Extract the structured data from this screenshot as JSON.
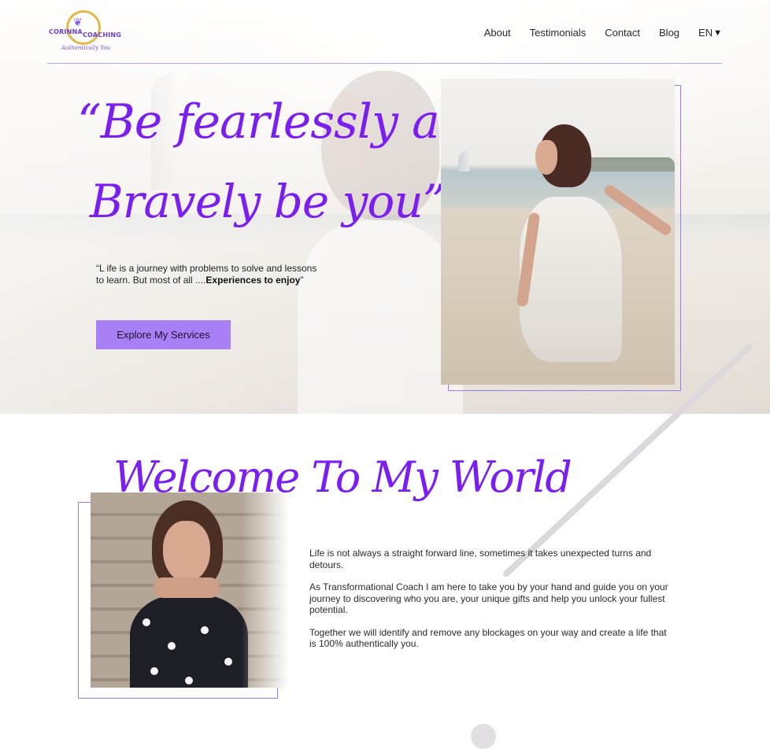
{
  "header": {
    "logo": {
      "name_left": "CORINNA",
      "name_right": "COACHING",
      "tagline": "Authentically You"
    },
    "nav": [
      {
        "label": "About"
      },
      {
        "label": "Testimonials"
      },
      {
        "label": "Contact"
      },
      {
        "label": "Blog"
      }
    ],
    "language": "EN"
  },
  "hero": {
    "quote_line1": "“Be fearlessly authentic.",
    "quote_line2": "Bravely be you”",
    "subtext_regular": "“L ife is a journey with problems to solve and lessons to learn. But most of all ....",
    "subtext_bold": "Experiences to enjoy",
    "subtext_end": "”",
    "cta_label": "Explore My Services"
  },
  "welcome": {
    "title": "Welcome To My World",
    "paragraphs": [
      "Life is not always a straight forward line, sometimes it takes unexpected turns and detours.",
      "As Transformational Coach I am here to take you by your hand and guide you on your journey to discovering who you are, your unique gifts and help you unlock your fullest potential.",
      "Together we will identify and remove any blockages on your way and create a life that is 100% authentically you."
    ]
  },
  "colors": {
    "accent": "#7b1ff0",
    "button": "#a97ff5",
    "frame": "#9c7be8"
  }
}
